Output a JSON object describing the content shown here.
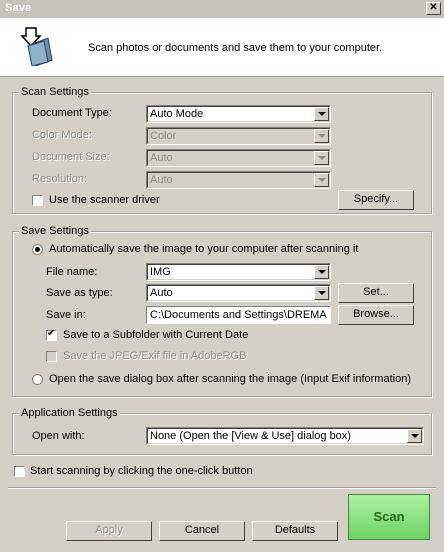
{
  "window": {
    "title": "Save"
  },
  "header": {
    "description": "Scan photos or documents and save them to your computer."
  },
  "scan_settings": {
    "legend": "Scan Settings",
    "document_type": {
      "label": "Document Type:",
      "value": "Auto Mode"
    },
    "color_mode": {
      "label": "Color Mode:",
      "value": "Color"
    },
    "document_size": {
      "label": "Document Size:",
      "value": "Auto"
    },
    "resolution": {
      "label": "Resolution:",
      "value": "Auto"
    },
    "use_driver": {
      "label": "Use the scanner driver",
      "checked": false
    },
    "specify_button": "Specify..."
  },
  "save_settings": {
    "legend": "Save Settings",
    "auto_save": {
      "label": "Automatically save the image to your computer after scanning it",
      "selected": true
    },
    "file_name": {
      "label": "File name:",
      "value": "IMG"
    },
    "save_as_type": {
      "label": "Save as type:",
      "value": "Auto"
    },
    "set_button": "Set...",
    "save_in": {
      "label": "Save in:",
      "value": "C:\\Documents and Settings\\DREMALEY\\"
    },
    "browse_button": "Browse...",
    "subfolder": {
      "label": "Save to a Subfolder with Current Date",
      "checked": true
    },
    "adobergb": {
      "label": "Save the JPEG/Exif file in AdobeRGB",
      "checked": false
    },
    "open_dialog": {
      "label": "Open the save dialog box after scanning the image (Input Exif information)",
      "selected": false
    }
  },
  "application_settings": {
    "legend": "Application Settings",
    "open_with": {
      "label": "Open with:",
      "value": "None (Open the [View & Use] dialog box)"
    }
  },
  "one_click": {
    "label": "Start scanning by clicking the one-click button",
    "checked": false
  },
  "buttons": {
    "apply": "Apply",
    "cancel": "Cancel",
    "defaults": "Defaults",
    "scan": "Scan"
  },
  "colors": {
    "scan_button": "#7ddc72",
    "scan_text": "#236a1c"
  }
}
